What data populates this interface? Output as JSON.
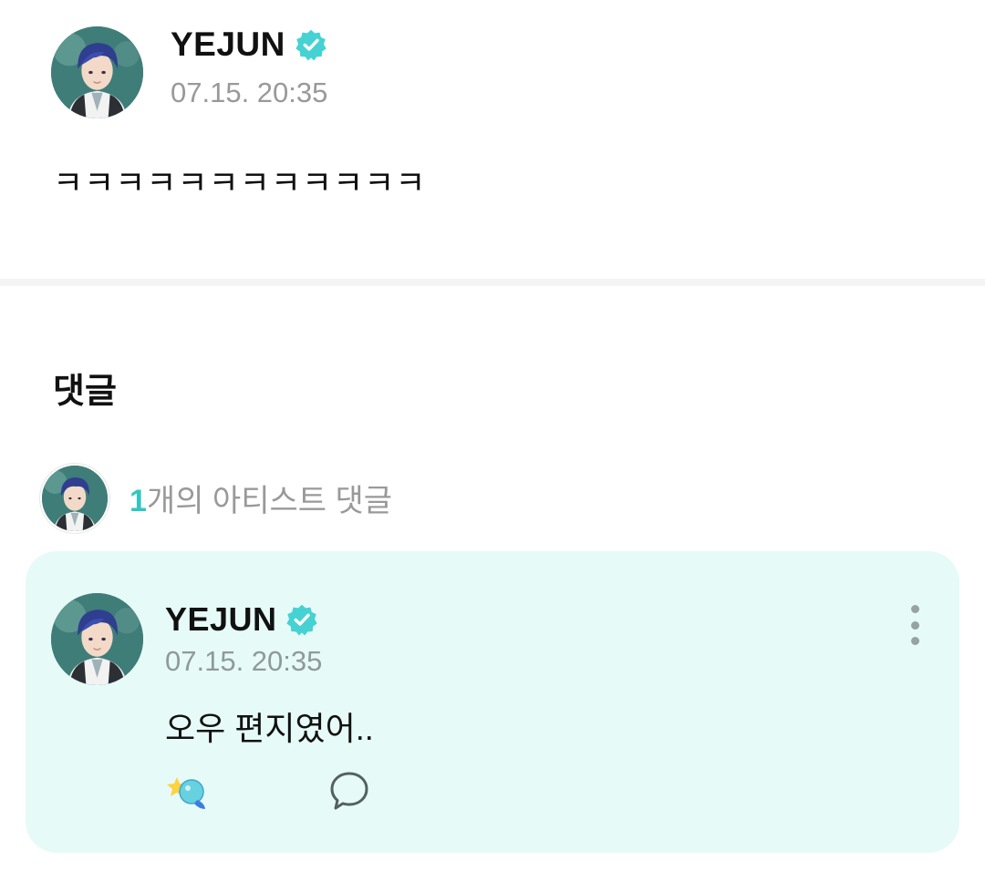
{
  "post": {
    "author": "YEJUN",
    "timestamp": "07.15. 20:35",
    "body": "ㅋㅋㅋㅋㅋㅋㅋㅋㅋㅋㅋㅋ",
    "verified_icon": "verified-badge-icon",
    "avatar": "artist-avatar"
  },
  "comments_section": {
    "title": "댓글",
    "artist_summary": {
      "count": "1",
      "label": "개의 아티스트 댓글"
    }
  },
  "comment": {
    "author": "YEJUN",
    "timestamp": "07.15. 20:35",
    "body": "오우 편지였어..",
    "icons": [
      "verified-badge-icon",
      "more-vertical-icon",
      "reaction-icon",
      "reply-bubble-icon"
    ]
  },
  "colors": {
    "accent": "#2fc7c0",
    "verified": "#46d2d2",
    "card_background": "#e6fbf8",
    "muted_text": "#999999"
  }
}
